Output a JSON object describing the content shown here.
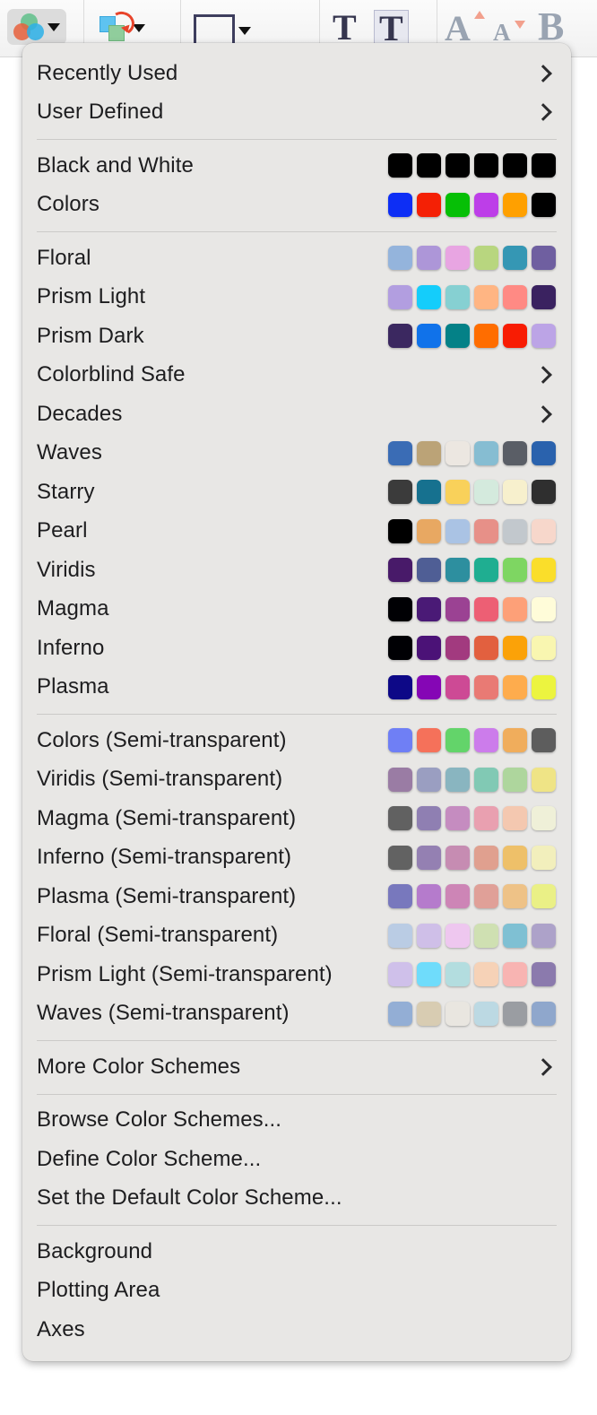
{
  "toolbar": {
    "buttons": [
      {
        "name": "color-scheme-dropdown",
        "icon": "venn-circles-icon",
        "active": true
      },
      {
        "name": "arrange-objects-dropdown",
        "icon": "shapes-rotate-icon",
        "active": false
      },
      {
        "name": "shape-style-dropdown",
        "icon": "rectangle-outline-icon",
        "active": false
      },
      {
        "name": "text-tool",
        "icon": "serif-t-icon",
        "active": false
      },
      {
        "name": "text-box-tool",
        "icon": "serif-t-boxed-icon",
        "active": true
      },
      {
        "name": "increase-font-size",
        "icon": "font-grow-icon",
        "active": false
      },
      {
        "name": "decrease-font-size",
        "icon": "font-shrink-icon",
        "active": false
      },
      {
        "name": "bold",
        "icon": "bold-b-icon",
        "active": false
      }
    ]
  },
  "menu": {
    "title": "Color Scheme Menu",
    "groups": [
      {
        "name": "submenu-group",
        "items": [
          {
            "label": "Recently Used",
            "submenu": true
          },
          {
            "label": "User Defined",
            "submenu": true
          }
        ]
      },
      {
        "name": "basic-group",
        "items": [
          {
            "label": "Black and White",
            "colors": [
              "#000000",
              "#000000",
              "#000000",
              "#000000",
              "#000000",
              "#000000"
            ]
          },
          {
            "label": "Colors",
            "colors": [
              "#0d2ef5",
              "#f42005",
              "#06bf06",
              "#bd3ee8",
              "#ffa000",
              "#000000"
            ]
          }
        ]
      },
      {
        "name": "scheme-group",
        "items": [
          {
            "label": "Floral",
            "colors": [
              "#94b4dc",
              "#ad96d8",
              "#e8a5e2",
              "#b8d67f",
              "#3597b4",
              "#6f5fa0"
            ]
          },
          {
            "label": "Prism Light",
            "colors": [
              "#b29ee0",
              "#14cdfb",
              "#86d0d2",
              "#ffb583",
              "#ff8a84",
              "#3a2260"
            ]
          },
          {
            "label": "Prism Dark",
            "colors": [
              "#3b2860",
              "#1072ea",
              "#048187",
              "#ff6d00",
              "#f81c03",
              "#bca4e6"
            ]
          },
          {
            "label": "Colorblind Safe",
            "submenu": true
          },
          {
            "label": "Decades",
            "submenu": true
          },
          {
            "label": "Waves",
            "colors": [
              "#3a6cb5",
              "#bba377",
              "#ece7e1",
              "#86bdd2",
              "#5a5e66",
              "#2a62ad"
            ]
          },
          {
            "label": "Starry",
            "colors": [
              "#3b3b3b",
              "#16718f",
              "#f9d15a",
              "#d4eadd",
              "#f7f0cd",
              "#2f2f2f"
            ]
          },
          {
            "label": "Pearl",
            "colors": [
              "#000000",
              "#e8a862",
              "#aac3e4",
              "#e79088",
              "#c2c8cd",
              "#f7d7cb"
            ]
          },
          {
            "label": "Viridis",
            "colors": [
              "#481a69",
              "#4f5e95",
              "#2d8f9f",
              "#1fae91",
              "#7ed662",
              "#fade2a"
            ]
          },
          {
            "label": "Magma",
            "colors": [
              "#000004",
              "#4a1a76",
              "#9b4293",
              "#ed5f74",
              "#fda078",
              "#fffcd9"
            ]
          },
          {
            "label": "Inferno",
            "colors": [
              "#000004",
              "#4b1277",
              "#a23a7f",
              "#e2603f",
              "#fba208",
              "#f9f6b0"
            ]
          },
          {
            "label": "Plasma",
            "colors": [
              "#0d0887",
              "#8506b5",
              "#cd4a95",
              "#e97a74",
              "#feac4d",
              "#ecf43f"
            ]
          }
        ]
      },
      {
        "name": "semi-transparent-group",
        "items": [
          {
            "label": "Colors (Semi-transparent)",
            "colors": [
              "#6f7ff5",
              "#f5715a",
              "#63d46a",
              "#cc7ceb",
              "#f0ad5c",
              "#5d5d5d"
            ]
          },
          {
            "label": "Viridis (Semi-transparent)",
            "colors": [
              "#9a7ca4",
              "#9a9ec1",
              "#89b5c0",
              "#81c9b4",
              "#aed69d",
              "#efe486"
            ]
          },
          {
            "label": "Magma (Semi-transparent)",
            "colors": [
              "#616161",
              "#8f7fb2",
              "#c58cc0",
              "#e9a0b0",
              "#f4c8b0",
              "#eff0d8"
            ]
          },
          {
            "label": "Inferno (Semi-transparent)",
            "colors": [
              "#626262",
              "#9480b2",
              "#c68cb2",
              "#e0a08f",
              "#eec069",
              "#f2efbc"
            ]
          },
          {
            "label": "Plasma (Semi-transparent)",
            "colors": [
              "#7878bd",
              "#b57bcc",
              "#cd85b6",
              "#e0a098",
              "#eec287",
              "#eaf086"
            ]
          },
          {
            "label": "Floral (Semi-transparent)",
            "colors": [
              "#bacce4",
              "#cfbfe8",
              "#eec7ef",
              "#cfe0b2",
              "#7fc0d3",
              "#ada2c9"
            ]
          },
          {
            "label": "Prism Light (Semi-transparent)",
            "colors": [
              "#cfc0ea",
              "#6fdcfb",
              "#b3dddf",
              "#f6d2b7",
              "#f8b4b2",
              "#8b7aad"
            ]
          },
          {
            "label": "Waves (Semi-transparent)",
            "colors": [
              "#93aed5",
              "#d8ccb2",
              "#e9e6e0",
              "#bcd9e3",
              "#9a9da2",
              "#8fa7cc"
            ]
          }
        ]
      },
      {
        "name": "more-group",
        "items": [
          {
            "label": "More Color Schemes",
            "submenu": true
          }
        ]
      },
      {
        "name": "dialog-group",
        "items": [
          {
            "label": "Browse Color Schemes..."
          },
          {
            "label": "Define Color Scheme..."
          },
          {
            "label": "Set the Default Color Scheme..."
          }
        ]
      },
      {
        "name": "target-group",
        "items": [
          {
            "label": "Background"
          },
          {
            "label": "Plotting Area"
          },
          {
            "label": "Axes"
          }
        ]
      }
    ]
  }
}
